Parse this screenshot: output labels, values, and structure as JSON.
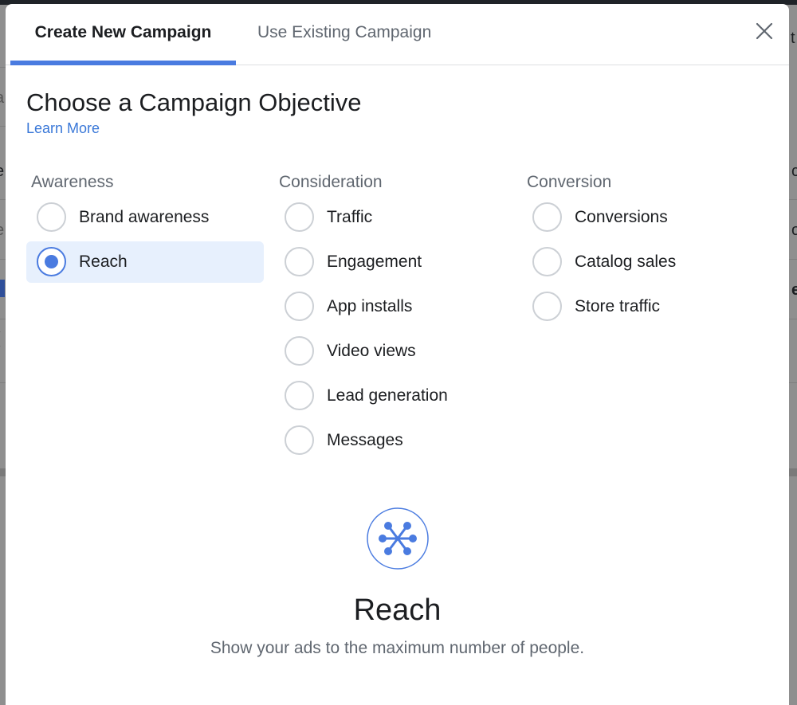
{
  "modal": {
    "tabs": [
      {
        "label": "Create New Campaign",
        "active": true
      },
      {
        "label": "Use Existing Campaign",
        "active": false
      }
    ],
    "close_icon": "close-icon"
  },
  "header": {
    "title": "Choose a Campaign Objective",
    "learn_more": "Learn More"
  },
  "columns": [
    {
      "heading": "Awareness",
      "options": [
        {
          "label": "Brand awareness",
          "selected": false
        },
        {
          "label": "Reach",
          "selected": true
        }
      ]
    },
    {
      "heading": "Consideration",
      "options": [
        {
          "label": "Traffic",
          "selected": false
        },
        {
          "label": "Engagement",
          "selected": false
        },
        {
          "label": "App installs",
          "selected": false
        },
        {
          "label": "Video views",
          "selected": false
        },
        {
          "label": "Lead generation",
          "selected": false
        },
        {
          "label": "Messages",
          "selected": false
        }
      ]
    },
    {
      "heading": "Conversion",
      "options": [
        {
          "label": "Conversions",
          "selected": false
        },
        {
          "label": "Catalog sales",
          "selected": false
        },
        {
          "label": "Store traffic",
          "selected": false
        }
      ]
    }
  ],
  "detail": {
    "icon": "reach-network-icon",
    "title": "Reach",
    "description": "Show your ads to the maximum number of people."
  },
  "background_fragments": {
    "right_top": "t",
    "left_1": "a",
    "left_2": "e",
    "left_3": "e",
    "left_4": "(",
    "right_1": "c",
    "right_2": "o",
    "right_3": "e"
  },
  "colors": {
    "accent": "#4a7be0",
    "link": "#3a78d8",
    "selected_bg": "#e7f0fd",
    "text": "#1c1e21",
    "muted_text": "#606770"
  }
}
